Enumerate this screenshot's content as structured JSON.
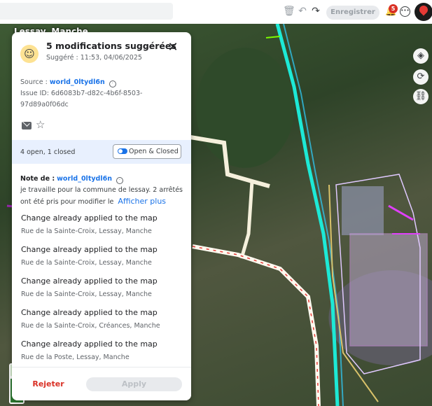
{
  "map": {
    "place_label": "Lessay, Manche"
  },
  "topbar": {
    "save_label": "Enregistrer",
    "notification_count": "5",
    "icons": [
      "trash-icon",
      "undo-icon",
      "redo-icon",
      "notification-icon",
      "chat-icon",
      "avatar"
    ]
  },
  "map_controls": [
    "layers-icon",
    "refresh-icon",
    "link-icon"
  ],
  "panel": {
    "title": "5 modifications suggérées",
    "subtitle": "Suggéré : 11:53, 04/06/2025",
    "source_label": "Source :",
    "source_user": "world_0ltydl6n",
    "issue_line1": "Issue ID: 6d6083b7-d82c-4b6f-8503-",
    "issue_line2": "97d89a0f06dc",
    "filter_text": "4 open, 1 closed",
    "filter_button": "Open & Closed",
    "note_label": "Note de :",
    "note_user": "world_0ltydl6n",
    "note_line1": "je travaille pour la commune de lessay. 2 arrêtés",
    "note_line2": "ont été pris pour modifier le",
    "show_more": "Afficher plus",
    "changes": [
      {
        "title": "Change already applied to the map",
        "address": "Rue de la Sainte-Croix, Lessay, Manche"
      },
      {
        "title": "Change already applied to the map",
        "address": "Rue de la Sainte-Croix, Lessay, Manche"
      },
      {
        "title": "Change already applied to the map",
        "address": "Rue de la Sainte-Croix, Lessay, Manche"
      },
      {
        "title": "Change already applied to the map",
        "address": "Rue de la Sainte-Croix, Créances, Manche"
      },
      {
        "title": "Change already applied to the map",
        "address": "Rue de la Poste, Lessay, Manche"
      }
    ],
    "reject_label": "Rejeter",
    "apply_label": "Apply"
  },
  "colors": {
    "accent": "#1a73e8",
    "danger": "#d93025",
    "road_cyan": "#1de9d6"
  }
}
